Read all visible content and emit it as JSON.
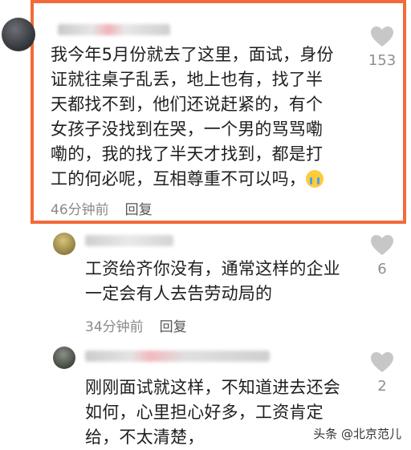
{
  "comments": [
    {
      "text_lines": [
        "我今年5月份就去了这里，面试，身份",
        "证就往桌子乱丢，地上也有，找了半",
        "天都找不到，他们还说赶紧的，有个",
        "女孩子没找到在哭，一个男的骂骂嘞",
        "嘞的，我的找了半天才找到，都是打",
        "工的何必呢，互相尊重不可以吗，"
      ],
      "emoji": "crying-face",
      "time": "46分钟前",
      "reply_label": "回复",
      "likes": "153"
    },
    {
      "text_lines": [
        "工资给齐你没有，通常这样的企业",
        "一定会有人去告劳动局的"
      ],
      "time": "34分钟前",
      "reply_label": "回复",
      "likes": "6"
    },
    {
      "text_lines": [
        "刚刚面试就这样，不知道进去还会",
        "如何，心里担心好多，工资肯定",
        "给，不太清楚，"
      ],
      "likes": "2"
    }
  ],
  "watermark": "头条 @北京范儿",
  "colors": {
    "highlight": "#f26b3a",
    "meta_text": "#8a8a8a"
  }
}
